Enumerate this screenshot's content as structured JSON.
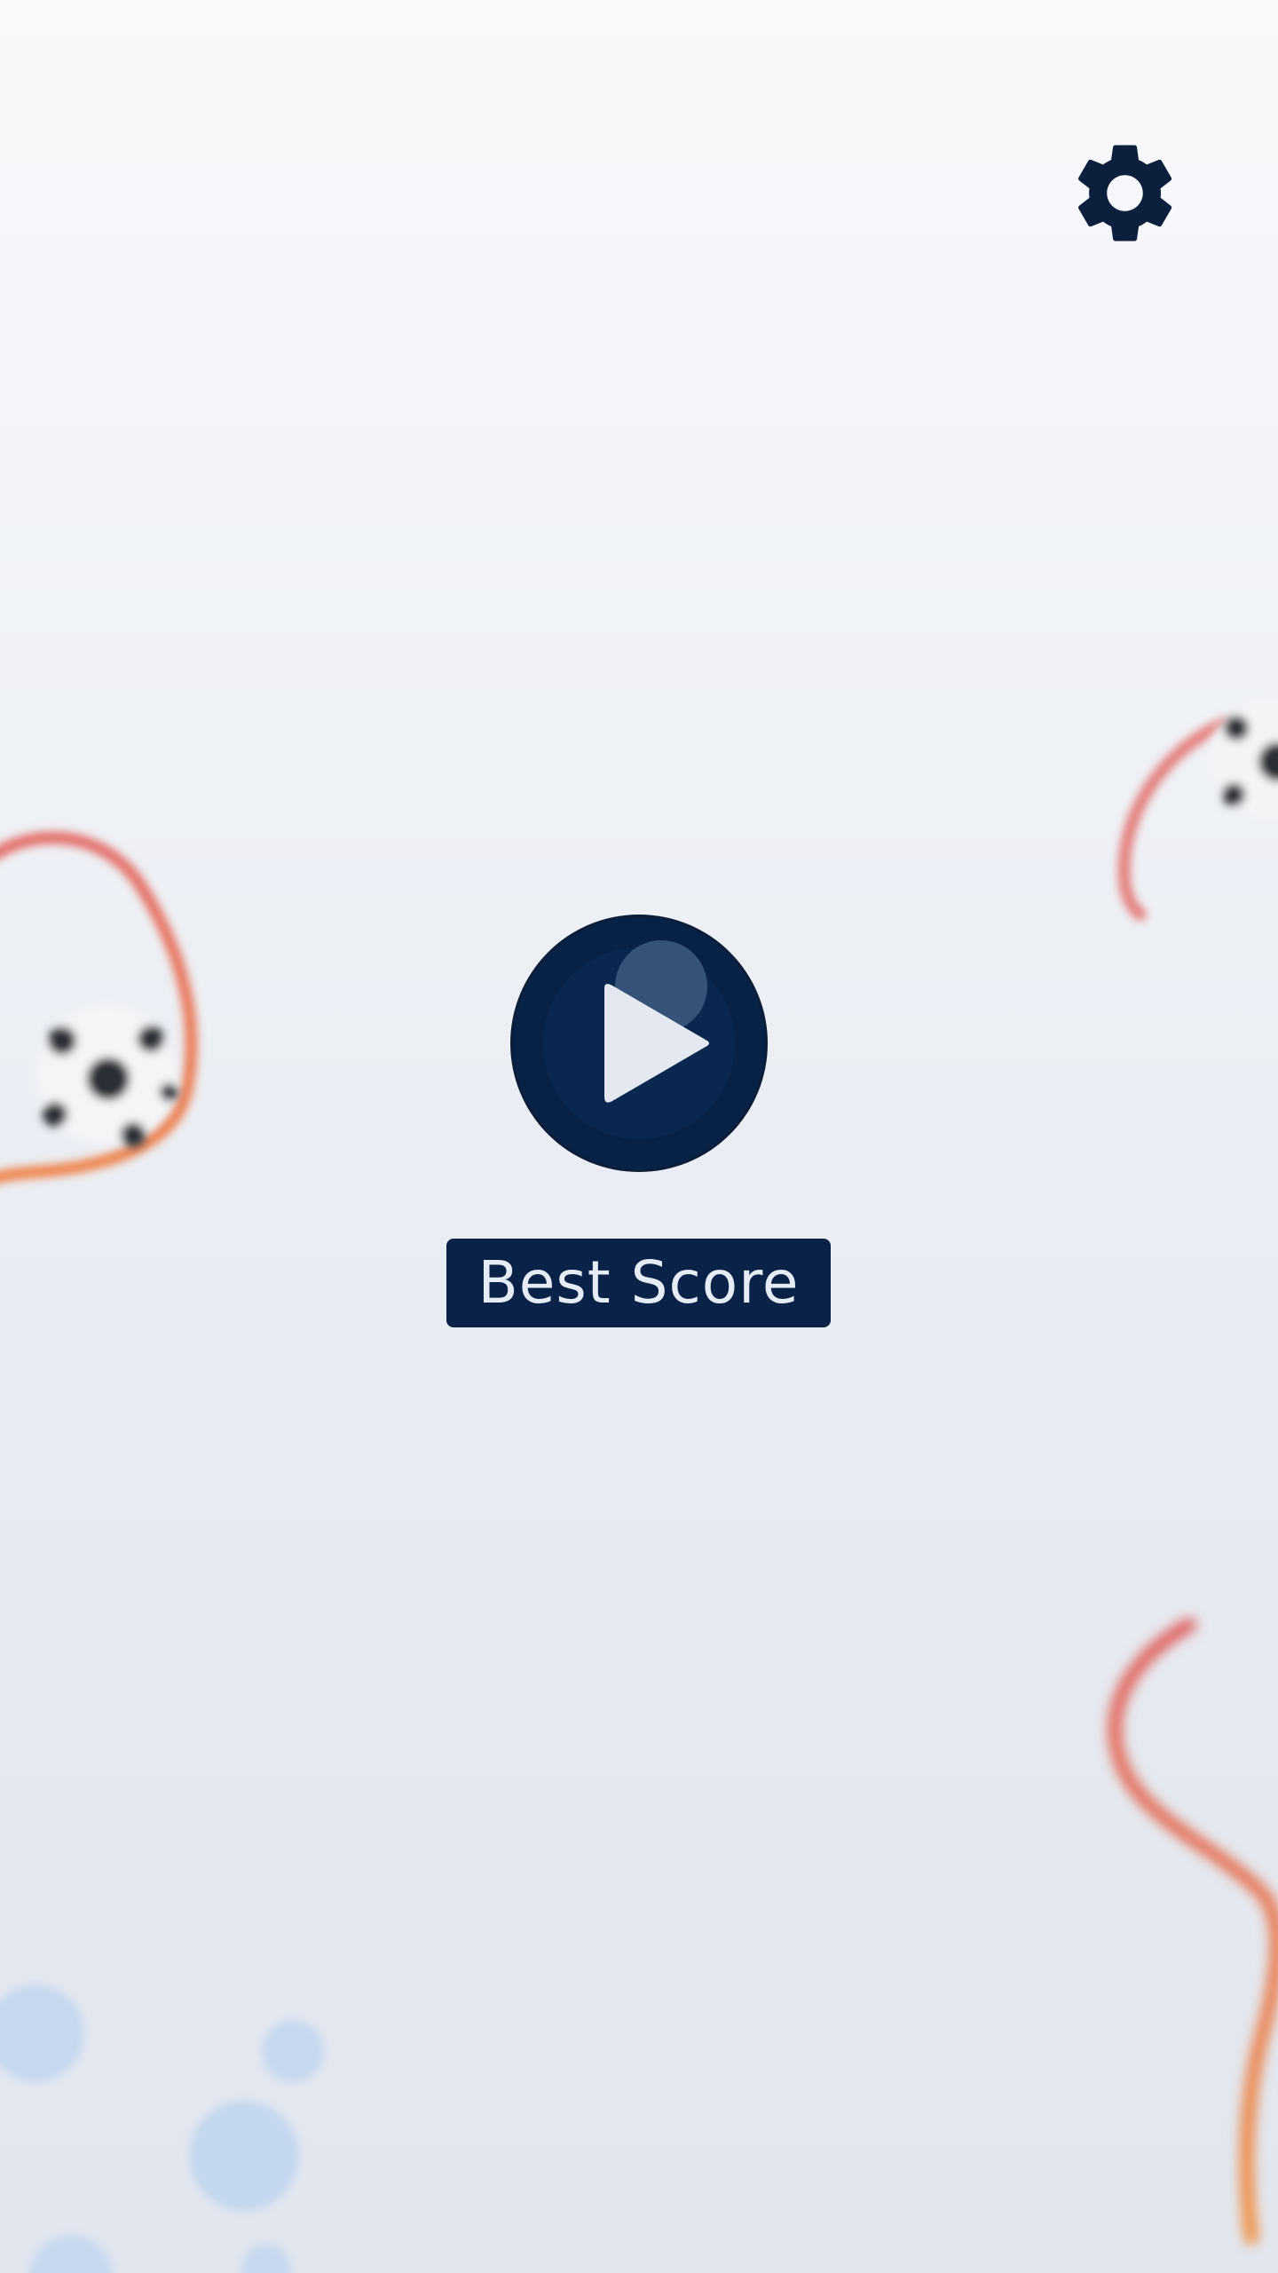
{
  "menu": {
    "play_icon": "play-icon",
    "settings_icon": "gear-icon",
    "best_score_label": "Best Score"
  },
  "colors": {
    "navy": "#082247",
    "play_glyph": "#e3e8f1",
    "trail_red": "#e05a55",
    "bubble_blue": "#bcd3ee",
    "background_top": "#f8f9fb",
    "background_bottom": "#e1e6ef"
  }
}
